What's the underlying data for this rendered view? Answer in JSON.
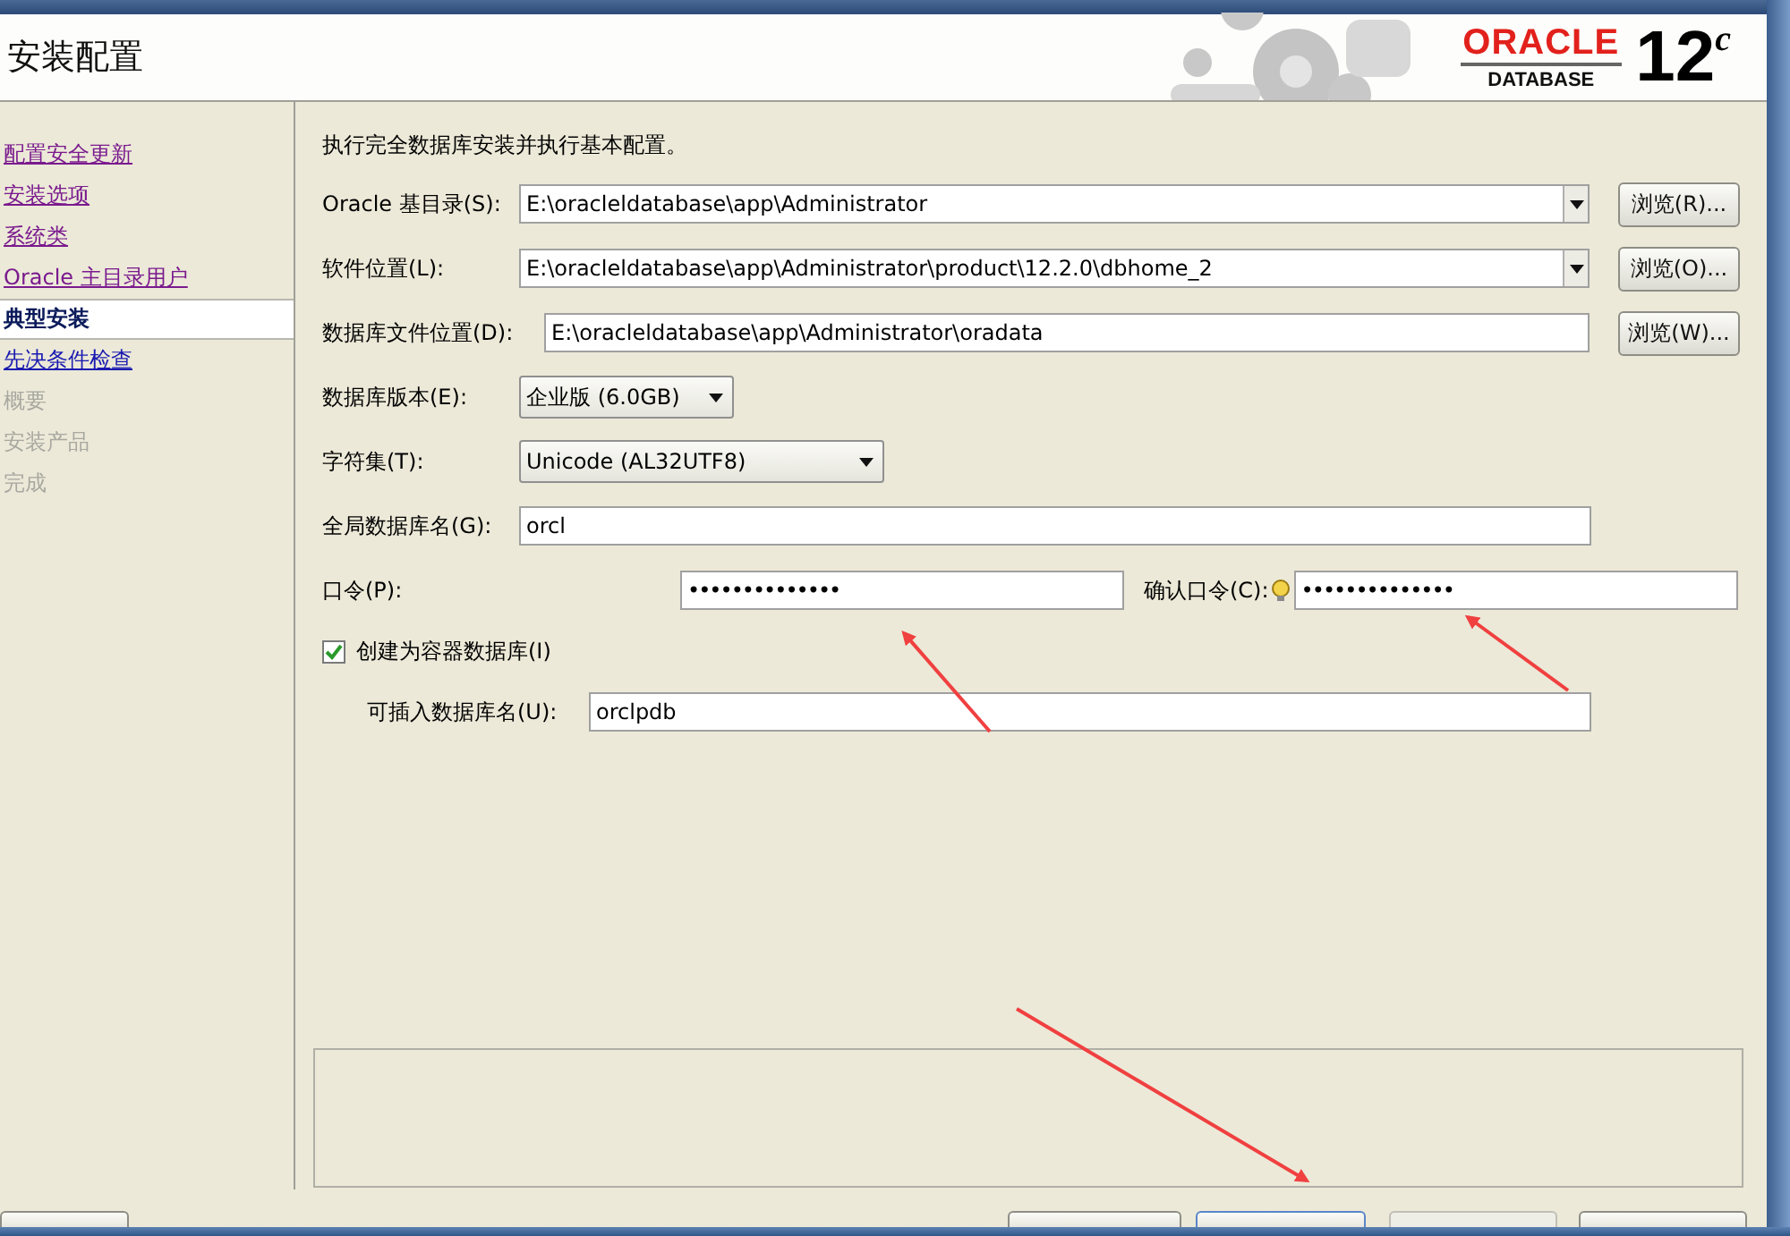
{
  "header": {
    "title": "安装配置",
    "logo": {
      "brand": "ORACLE",
      "product": "DATABASE",
      "version": "12",
      "suffix": "c"
    }
  },
  "steps": [
    {
      "label": "配置安全更新",
      "kind": "visited",
      "selected": false
    },
    {
      "label": "安装选项",
      "kind": "visited",
      "selected": false
    },
    {
      "label": "系统类",
      "kind": "visited",
      "selected": false
    },
    {
      "label": "Oracle 主目录用户",
      "kind": "visited",
      "selected": false
    },
    {
      "label": "典型安装",
      "kind": "current",
      "selected": true
    },
    {
      "label": "先决条件检查",
      "kind": "link",
      "selected": false
    },
    {
      "label": "概要",
      "kind": "pending",
      "selected": false
    },
    {
      "label": "安装产品",
      "kind": "pending",
      "selected": false
    },
    {
      "label": "完成",
      "kind": "pending",
      "selected": false
    }
  ],
  "description": "执行完全数据库安装并执行基本配置。",
  "rows": [
    {
      "kind": "combo",
      "label": "Oracle 基目录(S):",
      "value": "E:\\oracleldatabase\\app\\Administrator",
      "button": "浏览(R)..."
    },
    {
      "kind": "combo",
      "label": "软件位置(L):",
      "value": "E:\\oracleldatabase\\app\\Administrator\\product\\12.2.0\\dbhome_2",
      "button": "浏览(O)..."
    },
    {
      "kind": "text",
      "label": "数据库文件位置(D):",
      "value": "E:\\oracleldatabase\\app\\Administrator\\oradata",
      "button": "浏览(W)..."
    },
    {
      "kind": "select",
      "label": "数据库版本(E):",
      "value": "企业版 (6.0GB)"
    },
    {
      "kind": "select",
      "label": "字符集(T):",
      "value": "Unicode (AL32UTF8)"
    },
    {
      "kind": "text",
      "label": "全局数据库名(G):",
      "value": "orcl"
    },
    {
      "kind": "password",
      "label": "口令(P):",
      "value": "••••••••••••••",
      "confirm_label": "确认口令(C):",
      "confirm_value": "••••••••••••••"
    },
    {
      "kind": "checkbox",
      "label": "创建为容器数据库(I)",
      "checked": true
    },
    {
      "kind": "indented",
      "label": "可插入数据库名(U):",
      "value": "orclpdb"
    }
  ],
  "footer_buttons": [
    {
      "enabled": true
    },
    {
      "enabled": true
    },
    {
      "enabled": true
    },
    {
      "enabled": false
    },
    {
      "enabled": true
    }
  ]
}
